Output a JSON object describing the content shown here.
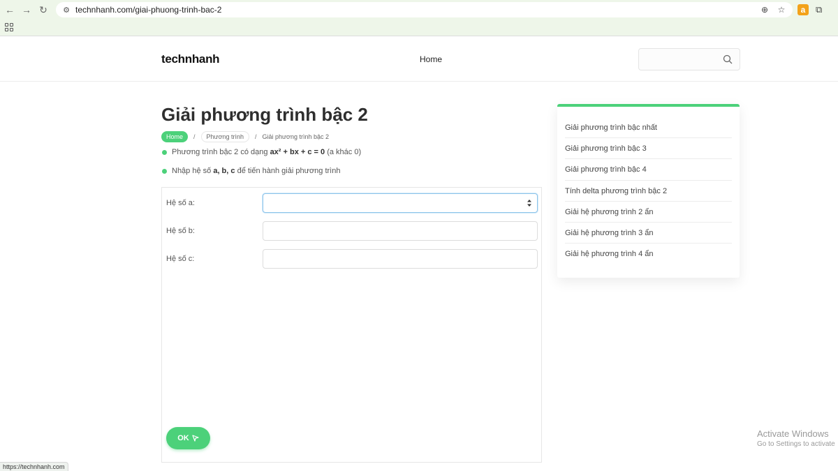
{
  "browser": {
    "url": "technhanh.com/giai-phuong-trinh-bac-2",
    "status_text": "https://technhanh.com"
  },
  "site": {
    "logo_text": "technhanh",
    "nav_home": "Home",
    "search_placeholder": ""
  },
  "main": {
    "title": "Giải phương trình bậc 2",
    "breadcrumb": {
      "home": "Home",
      "sep": "/",
      "category": "Phương trình",
      "current": "Giải phương trình bậc 2"
    },
    "bullets": {
      "b1_pre": "Phương trình bậc 2 có dạng ",
      "b1_formula": "ax² + bx + c = 0",
      "b1_post": " (a khác 0)",
      "b2_pre": "Nhập hệ số ",
      "b2_bold": "a, b, c",
      "b2_post": " để tiến hành giải phương trình"
    },
    "form": {
      "label_a": "Hệ số a:",
      "label_b": "Hệ số b:",
      "label_c": "Hệ số c:",
      "value_a": "",
      "value_b": "",
      "value_c": "",
      "ok_label": "OK"
    }
  },
  "sidebar": {
    "items": [
      "Giải phương trình bậc nhất",
      "Giải phương trình bậc 3",
      "Giải phương trình bậc 4",
      "Tính delta phương trình bậc 2",
      "Giải hệ phương trình 2 ẩn",
      "Giải hệ phương trình 3 ẩn",
      "Giải hệ phương trình 4 ẩn"
    ]
  },
  "watermark": {
    "title": "Activate Windows",
    "subtitle": "Go to Settings to activate"
  },
  "colors": {
    "accent": "#4cd17a",
    "chrome": "#eef6e9"
  }
}
